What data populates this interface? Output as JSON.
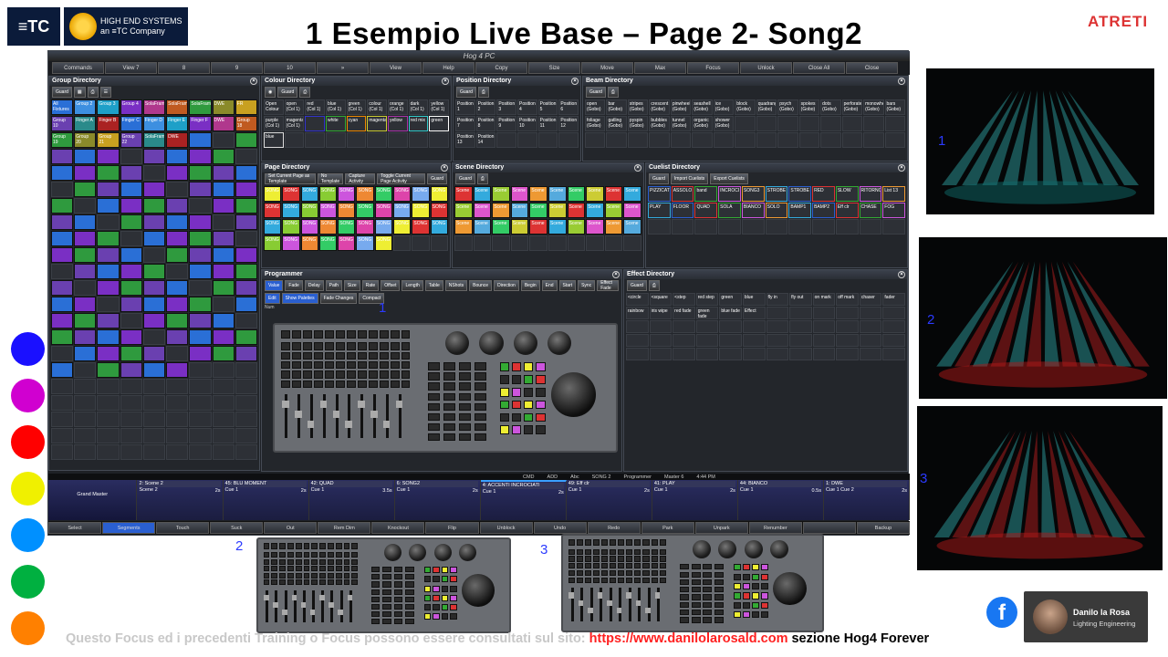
{
  "slide": {
    "title": "1 Esempio  Live  Base – Page 2- Song2",
    "logos": {
      "etc": "≡TC",
      "hes_line1": "HIGH END SYSTEMS",
      "hes_line2": "an ≡TC Company",
      "atreti": "ATRETI"
    },
    "footer": {
      "text": "Questo Focus ed i precedenti Training o Focus possono essere consultati sul sito: ",
      "url": "https://www.danilolarosald.com",
      "tail": "  sezione Hog4 Forever"
    },
    "author": {
      "name": "Danilo la Rosa",
      "role": "Lighting Engineering"
    },
    "facebook": "f",
    "numbers": {
      "programmer_1": "1",
      "console_2": "2",
      "console_3": "3",
      "stage_1": "1",
      "stage_2": "2",
      "stage_3": "3"
    },
    "palette_colors": [
      "#ffffff",
      "#1a10ff",
      "#d000d0",
      "#ff0000",
      "#f0f000",
      "#0090ff",
      "#00b040",
      "#ff8000"
    ]
  },
  "hog": {
    "window_title": "Hog 4 PC",
    "toolbar": [
      "Commands",
      "View 7",
      "8",
      "9",
      "10",
      "»",
      "View",
      "Help",
      "Copy",
      "Size",
      "Move",
      "Max",
      "Focus",
      "Unlock",
      "Close All",
      "Close"
    ],
    "panels": {
      "group": {
        "title": "Group Directory",
        "tool": "Guard"
      },
      "colour": {
        "title": "Colour Directory",
        "tool": "Guard"
      },
      "position": {
        "title": "Position Directory",
        "tool": "Guard"
      },
      "beam": {
        "title": "Beam Directory",
        "tool": "Guard"
      },
      "page": {
        "title": "Page Directory",
        "tools": [
          "Set Current Page as Template",
          "No Template",
          "Capture Activity",
          "Toggle Current Page Activity",
          "Guard"
        ]
      },
      "scene": {
        "title": "Scene Directory",
        "tool": "Guard"
      },
      "cuelist": {
        "title": "Cuelist Directory",
        "tools": [
          "Guard",
          "Import Cuelists",
          "Export Cuelists"
        ]
      },
      "programmer": {
        "title": "Programmer",
        "tabs": [
          "Value",
          "Fade",
          "Delay",
          "Path",
          "Size",
          "Rate",
          "Offset",
          "Length",
          "Table",
          "NShots",
          "Bounce",
          "Direction",
          "Begin",
          "End",
          "Start",
          "Sync",
          "Effect Fade"
        ],
        "tools": [
          "Edit",
          "Show Palettes",
          "Fade Changes",
          "Compact"
        ],
        "num": "Num"
      },
      "effect": {
        "title": "Effect Directory",
        "tool": "Guard"
      }
    },
    "group_cells": [
      "All Fixtures",
      "Group 2",
      "Group 3",
      "Group 4",
      "SolaFrame",
      "SolaFrame",
      "SolaFrame",
      "DWE",
      "FR",
      "Group 10",
      "Finger A",
      "Finger B",
      "Finger C",
      "Finger D",
      "Finger E",
      "Finger F",
      "DWE",
      "Group 18",
      "Group 19",
      "Group 20",
      "Group 21",
      "Group 22",
      "SolaFrame",
      "DWE"
    ],
    "colour_cells": [
      "Open Colour",
      "open (Col 1)",
      "red (Col 1)",
      "blue (Col 1)",
      "green (Col 1)",
      "colour (Col 1)",
      "orange (Col 1)",
      "dark (Col 1)",
      "yellow (Col 1)",
      "purple (Col 1)",
      "magenta (Col 1)",
      "",
      "white",
      "cyan",
      "magenta",
      "yellow",
      "red mix",
      "green",
      "blue"
    ],
    "position_cells": [
      "Position 1",
      "Position 2",
      "Position 3",
      "Position 4",
      "Position 5",
      "Position 6",
      "Position 7",
      "Position 8",
      "Position 9",
      "Position 10",
      "Position 11",
      "Position 12",
      "Position 13",
      "Position 14"
    ],
    "beam_cells": [
      "open (Gobo)",
      "bar (Gobo)",
      "stripes (Gobo)",
      "crescent (Gobo)",
      "pinwheel (Gobo)",
      "seashell (Gobo)",
      "ice (Gobo)",
      "block (Gobo)",
      "quadrangle (Gobo)",
      "psych (Gobo)",
      "spokes (Gobo)",
      "dots (Gobo)",
      "perforated (Gobo)",
      "monowheel (Gobo)",
      "bars (Gobo)",
      "foliage (Gobo)",
      "gatling (Gobo)",
      "pyspin (Gobo)",
      "bubbles (Gobo)",
      "tunnel (Gobo)",
      "organic (Gobo)",
      "shower (Gobo)"
    ],
    "page_cells": [
      "SONG",
      "SONG",
      "SONG",
      "SONG",
      "SONG",
      "SONG",
      "SONG",
      "SONG",
      "SONG",
      "SONG",
      "SONG",
      "SONG",
      "SONG",
      "SONG",
      "SONG",
      "SONG",
      "SONG",
      "SONG",
      "SONG",
      "SONG",
      "SONG",
      "SONG",
      "SONG",
      "SONG",
      "SONG",
      "SONG",
      "SONG",
      "SONG",
      "SONG",
      "SONG",
      "SONG",
      "SONG",
      "SONG",
      "SONG",
      "SONG",
      "SONG",
      "SONG"
    ],
    "scene_cells": [
      "Scene",
      "Scene",
      "Scene",
      "Scene",
      "Scene",
      "Scene",
      "Scene",
      "Scene",
      "Scene",
      "Scene",
      "Scene",
      "Scene",
      "Scene",
      "Scene",
      "Scene",
      "Scene",
      "Scene",
      "Scene",
      "Scene",
      "Scene",
      "Scene",
      "Scene",
      "Scene",
      "Scene",
      "Scene",
      "Scene",
      "Scene",
      "Scene",
      "Scene",
      "Scene"
    ],
    "cuelist_cells": [
      "PIZZICATO",
      "ASSOLO",
      "band",
      "INCROCI",
      "SONG3",
      "STROBE",
      "STROBE",
      "RED",
      "SLOW",
      "RITORNO",
      "List 13",
      "PLAY",
      "FLOOR",
      "QUAD",
      "SOLA",
      "BIANCO",
      "SOLO",
      "BAMP1",
      "BAMP2",
      "Eff clr",
      "CHASE",
      "FOG"
    ],
    "effect_cells": [
      "<circle",
      "<square",
      "<step",
      "red step",
      "green",
      "blue",
      "fly in",
      "fly out",
      "on mark",
      "off mark",
      "chaser",
      "fader",
      "rainbow",
      "iris wipe",
      "red fade",
      "green fade",
      "blue fade",
      "Effect"
    ],
    "status_line": [
      "CMD",
      "ADD",
      "Abc",
      "SONG 2",
      "Programmer",
      "Master 6",
      "4:44 PM"
    ],
    "masters": [
      {
        "title": "Grand Master",
        "sub": ""
      },
      {
        "title": "2: Scene 2",
        "sub": "Scene 2",
        "time": "2s"
      },
      {
        "title": "45: BLU MOMENT",
        "sub": "Cue 1",
        "time": "2s"
      },
      {
        "title": "42: QUAD",
        "sub": "Cue 1",
        "time": "3.5s"
      },
      {
        "title": "6: SONG2",
        "sub": "Cue 1",
        "time": "2s"
      },
      {
        "title": "4: ACCENTI INCROCIATI",
        "sub": "Cue 1",
        "time": "2s"
      },
      {
        "title": "49: Eff clr",
        "sub": "Cue 1",
        "time": "2s"
      },
      {
        "title": "41: PLAY",
        "sub": "Cue 1",
        "time": "2s"
      },
      {
        "title": "44: BIANCO",
        "sub": "Cue 1",
        "time": "0.5s"
      },
      {
        "title": "1: DWE",
        "sub": "Cue 1 Cue 2",
        "time": "2s"
      }
    ],
    "keys": [
      "Select",
      "Segments",
      "Touch",
      "Suck",
      "Out",
      "Rem Dim",
      "Knockout",
      "Flip",
      "Unblock",
      "Undo",
      "Redo",
      "Park",
      "Unpark",
      "Renumber",
      "",
      "Backup"
    ]
  }
}
